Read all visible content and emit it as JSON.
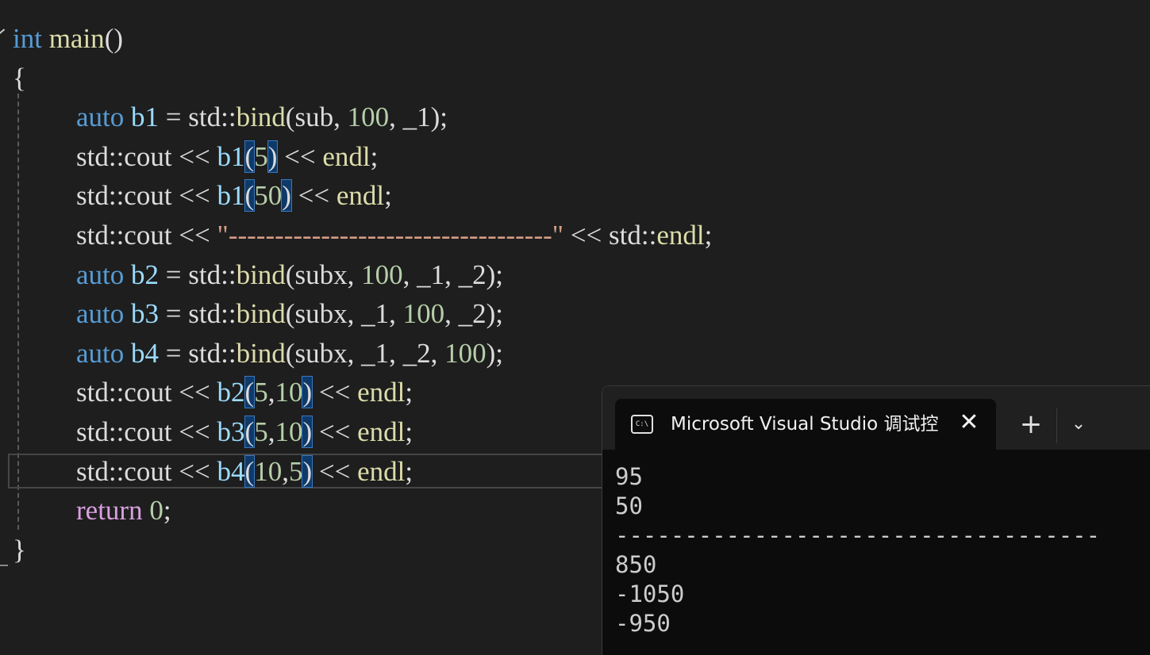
{
  "editor": {
    "lines": [
      [
        {
          "t": "int",
          "c": "kw"
        },
        {
          "t": " ",
          "c": "txt"
        },
        {
          "t": "main",
          "c": "fn"
        },
        {
          "t": "()",
          "c": "txt"
        }
      ],
      [
        {
          "t": "{",
          "c": "txt"
        }
      ],
      [
        {
          "t": "auto",
          "c": "kw"
        },
        {
          "t": " ",
          "c": "txt"
        },
        {
          "t": "b1",
          "c": "var"
        },
        {
          "t": " = std::",
          "c": "txt"
        },
        {
          "t": "bind",
          "c": "fn"
        },
        {
          "t": "(sub, ",
          "c": "txt"
        },
        {
          "t": "100",
          "c": "num"
        },
        {
          "t": ", _1);",
          "c": "txt"
        }
      ],
      [
        {
          "t": "std::cout << ",
          "c": "txt"
        },
        {
          "t": "b1",
          "c": "var"
        },
        {
          "t": "(",
          "c": "txt",
          "hl": true
        },
        {
          "t": "5",
          "c": "num"
        },
        {
          "t": ")",
          "c": "txt",
          "hl": true
        },
        {
          "t": " << ",
          "c": "txt"
        },
        {
          "t": "endl",
          "c": "fn"
        },
        {
          "t": ";",
          "c": "txt"
        }
      ],
      [
        {
          "t": "std::cout << ",
          "c": "txt"
        },
        {
          "t": "b1",
          "c": "var"
        },
        {
          "t": "(",
          "c": "txt",
          "hl": true
        },
        {
          "t": "50",
          "c": "num"
        },
        {
          "t": ")",
          "c": "txt",
          "hl": true
        },
        {
          "t": " << ",
          "c": "txt"
        },
        {
          "t": "endl",
          "c": "fn"
        },
        {
          "t": ";",
          "c": "txt"
        }
      ],
      [
        {
          "t": "std::cout << ",
          "c": "txt"
        },
        {
          "t": "\"-----------------------------------\"",
          "c": "str"
        },
        {
          "t": " << std::",
          "c": "txt"
        },
        {
          "t": "endl",
          "c": "fn"
        },
        {
          "t": ";",
          "c": "txt"
        }
      ],
      [
        {
          "t": "auto",
          "c": "kw"
        },
        {
          "t": " ",
          "c": "txt"
        },
        {
          "t": "b2",
          "c": "var"
        },
        {
          "t": " = std::",
          "c": "txt"
        },
        {
          "t": "bind",
          "c": "fn"
        },
        {
          "t": "(subx, ",
          "c": "txt"
        },
        {
          "t": "100",
          "c": "num"
        },
        {
          "t": ", _1, _2);",
          "c": "txt"
        }
      ],
      [
        {
          "t": "auto",
          "c": "kw"
        },
        {
          "t": " ",
          "c": "txt"
        },
        {
          "t": "b3",
          "c": "var"
        },
        {
          "t": " = std::",
          "c": "txt"
        },
        {
          "t": "bind",
          "c": "fn"
        },
        {
          "t": "(subx, _1, ",
          "c": "txt"
        },
        {
          "t": "100",
          "c": "num"
        },
        {
          "t": ", _2);",
          "c": "txt"
        }
      ],
      [
        {
          "t": "auto",
          "c": "kw"
        },
        {
          "t": " ",
          "c": "txt"
        },
        {
          "t": "b4",
          "c": "var"
        },
        {
          "t": " = std::",
          "c": "txt"
        },
        {
          "t": "bind",
          "c": "fn"
        },
        {
          "t": "(subx, _1, _2, ",
          "c": "txt"
        },
        {
          "t": "100",
          "c": "num"
        },
        {
          "t": ");",
          "c": "txt"
        }
      ],
      [
        {
          "t": "std::cout << ",
          "c": "txt"
        },
        {
          "t": "b2",
          "c": "var"
        },
        {
          "t": "(",
          "c": "txt",
          "hl": true
        },
        {
          "t": "5",
          "c": "num"
        },
        {
          "t": ",",
          "c": "txt"
        },
        {
          "t": "10",
          "c": "num"
        },
        {
          "t": ")",
          "c": "txt",
          "hl": true
        },
        {
          "t": " << ",
          "c": "txt"
        },
        {
          "t": "endl",
          "c": "fn"
        },
        {
          "t": ";",
          "c": "txt"
        }
      ],
      [
        {
          "t": "std::cout << ",
          "c": "txt"
        },
        {
          "t": "b3",
          "c": "var"
        },
        {
          "t": "(",
          "c": "txt",
          "hl": true
        },
        {
          "t": "5",
          "c": "num"
        },
        {
          "t": ",",
          "c": "txt"
        },
        {
          "t": "10",
          "c": "num"
        },
        {
          "t": ")",
          "c": "txt",
          "hl": true
        },
        {
          "t": " << ",
          "c": "txt"
        },
        {
          "t": "endl",
          "c": "fn"
        },
        {
          "t": ";",
          "c": "txt"
        }
      ],
      [
        {
          "t": "std::cout << ",
          "c": "txt"
        },
        {
          "t": "b4",
          "c": "var"
        },
        {
          "t": "(",
          "c": "txt",
          "hl": true
        },
        {
          "t": "10",
          "c": "num"
        },
        {
          "t": ",",
          "c": "txt"
        },
        {
          "t": "5",
          "c": "num"
        },
        {
          "t": ")",
          "c": "txt",
          "hl": true
        },
        {
          "t": " << ",
          "c": "txt"
        },
        {
          "t": "endl",
          "c": "fn"
        },
        {
          "t": ";",
          "c": "txt"
        }
      ],
      [
        {
          "t": "return",
          "c": "ret"
        },
        {
          "t": " ",
          "c": "txt"
        },
        {
          "t": "0",
          "c": "num"
        },
        {
          "t": ";",
          "c": "txt"
        }
      ],
      [
        {
          "t": "}",
          "c": "txt"
        }
      ]
    ]
  },
  "terminal": {
    "tab_title": "Microsoft Visual Studio 调试控",
    "tab_icon": "C:\\",
    "close_glyph": "✕",
    "new_tab_glyph": "+",
    "dropdown_glyph": "⌄",
    "output": [
      "95",
      "50",
      "-----------------------------------",
      "850",
      "-1050",
      "-950"
    ]
  }
}
